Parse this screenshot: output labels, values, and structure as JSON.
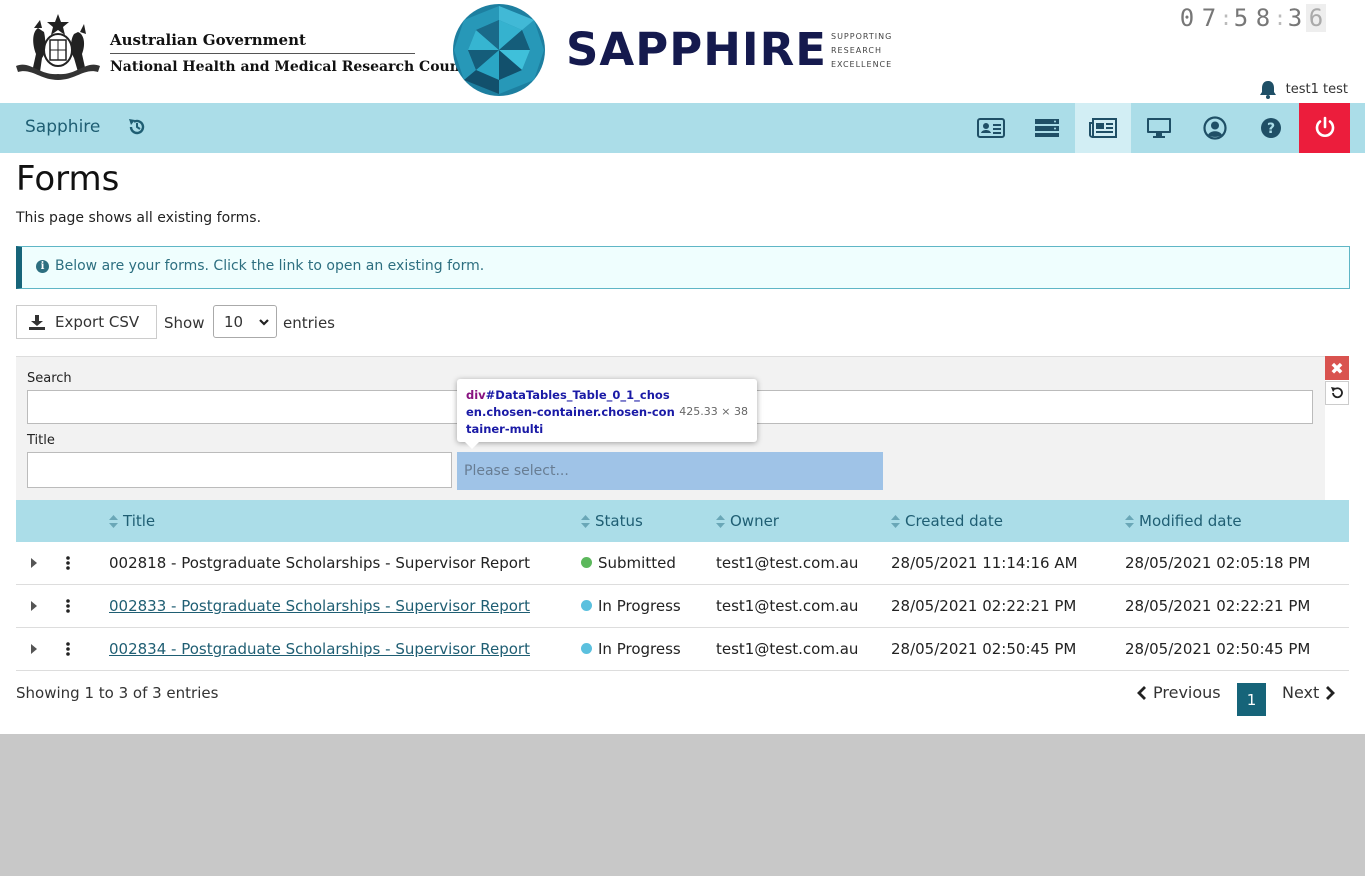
{
  "header": {
    "gov_line1": "Australian Government",
    "gov_line2": "National Health and Medical Research Council",
    "brand": "SAPPHIRE",
    "tagline": [
      "SUPPORTING",
      "RESEARCH",
      "EXCELLENCE"
    ],
    "clock_digits": [
      "0",
      "7",
      "5",
      "8",
      "3",
      "6"
    ],
    "user_name": "test1 test"
  },
  "nav": {
    "brand": "Sapphire",
    "icons": [
      "id-card-icon",
      "server-icon",
      "newspaper-icon",
      "monitor-icon",
      "user-circle-icon",
      "help-icon",
      "power-icon"
    ],
    "logout_color": "#ec1d3c",
    "bar_color": "#abdde8"
  },
  "page": {
    "title": "Forms",
    "subtitle": "This page shows all existing forms.",
    "alert": "Below are your forms. Click the link to open an existing form."
  },
  "toolbar": {
    "export_label": "Export CSV",
    "show_label": "Show",
    "entries_value": "10",
    "entries_label": "entries"
  },
  "filters": {
    "search_label": "Search",
    "title_label": "Title",
    "status_placeholder": "Please select..."
  },
  "tooltip": {
    "tag": "div",
    "selector": "#DataTables_Table_0_1_chosen.chosen-container.chosen-container-multi",
    "size": "425.33 × 38"
  },
  "table": {
    "columns": [
      "Title",
      "Status",
      "Owner",
      "Created date",
      "Modified date"
    ],
    "rows": [
      {
        "title": "002818 - Postgraduate Scholarships - Supervisor Report",
        "status": "Submitted",
        "status_color": "#5cb85c",
        "owner": "test1@test.com.au",
        "created": "28/05/2021 11:14:16 AM",
        "modified": "28/05/2021 02:05:18 PM"
      },
      {
        "title": "002833 - Postgraduate Scholarships - Supervisor Report",
        "status": "In Progress",
        "status_color": "#5bc0de",
        "owner": "test1@test.com.au",
        "created": "28/05/2021 02:22:21 PM",
        "modified": "28/05/2021 02:22:21 PM"
      },
      {
        "title": "002834 - Postgraduate Scholarships - Supervisor Report",
        "status": "In Progress",
        "status_color": "#5bc0de",
        "owner": "test1@test.com.au",
        "created": "28/05/2021 02:50:45 PM",
        "modified": "28/05/2021 02:50:45 PM"
      }
    ]
  },
  "footer": {
    "info": "Showing 1 to 3 of 3 entries",
    "previous": "Previous",
    "page": "1",
    "next": "Next"
  }
}
